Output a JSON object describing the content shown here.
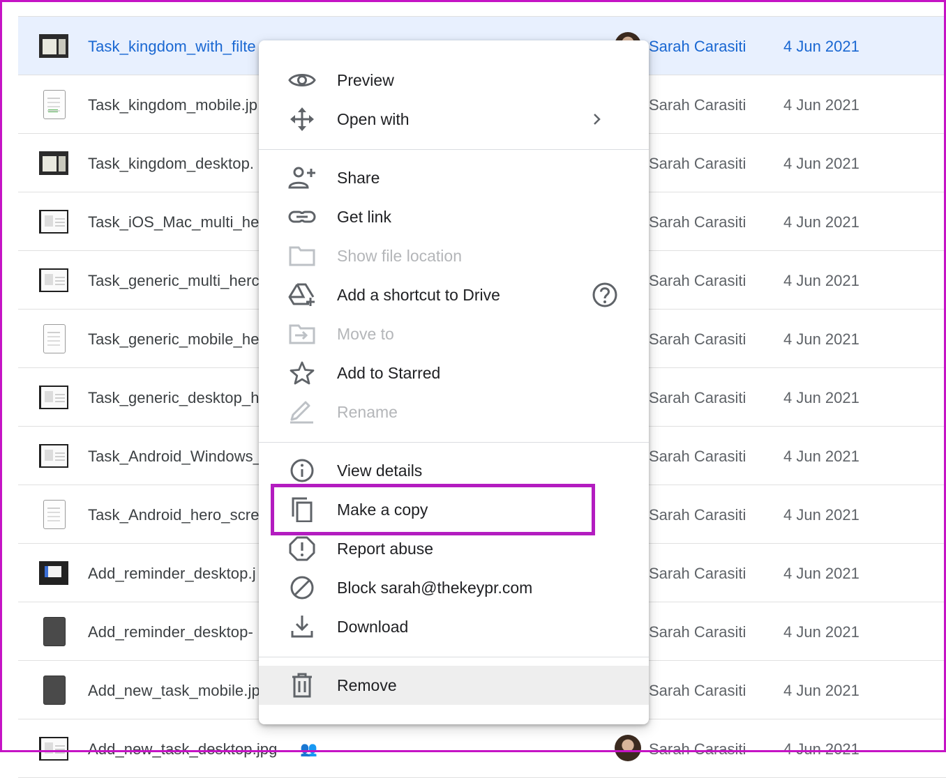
{
  "files": [
    {
      "name": "Task_kingdom_with_filte",
      "owner": "Sarah Carasiti",
      "modified": "4 Jun 2021",
      "thumb": "land dark",
      "selected": true,
      "shared": true
    },
    {
      "name": "Task_kingdom_mobile.jp",
      "owner": "Sarah Carasiti",
      "modified": "4 Jun 2021",
      "thumb": "port green"
    },
    {
      "name": "Task_kingdom_desktop.",
      "owner": "Sarah Carasiti",
      "modified": "4 Jun 2021",
      "thumb": "land dark"
    },
    {
      "name": "Task_iOS_Mac_multi_he",
      "owner": "Sarah Carasiti",
      "modified": "4 Jun 2021",
      "thumb": "land light"
    },
    {
      "name": "Task_generic_multi_herc",
      "owner": "Sarah Carasiti",
      "modified": "4 Jun 2021",
      "thumb": "land light"
    },
    {
      "name": "Task_generic_mobile_he",
      "owner": "Sarah Carasiti",
      "modified": "4 Jun 2021",
      "thumb": "port"
    },
    {
      "name": "Task_generic_desktop_h",
      "owner": "Sarah Carasiti",
      "modified": "4 Jun 2021",
      "thumb": "land light"
    },
    {
      "name": "Task_Android_Windows_",
      "owner": "Sarah Carasiti",
      "modified": "4 Jun 2021",
      "thumb": "land light"
    },
    {
      "name": "Task_Android_hero_scre",
      "owner": "Sarah Carasiti",
      "modified": "4 Jun 2021",
      "thumb": "port"
    },
    {
      "name": "Add_reminder_desktop.j",
      "owner": "Sarah Carasiti",
      "modified": "4 Jun 2021",
      "thumb": "land blue"
    },
    {
      "name": "Add_reminder_desktop-",
      "owner": "Sarah Carasiti",
      "modified": "4 Jun 2021",
      "thumb": "port dark"
    },
    {
      "name": "Add_new_task_mobile.jp",
      "owner": "Sarah Carasiti",
      "modified": "4 Jun 2021",
      "thumb": "port dark"
    },
    {
      "name": "Add_new_task_desktop.jpg",
      "owner": "Sarah Carasiti",
      "modified": "4 Jun 2021",
      "thumb": "land light",
      "shared": true,
      "avatar": true
    }
  ],
  "menu": {
    "preview": "Preview",
    "open_with": "Open with",
    "share": "Share",
    "get_link": "Get link",
    "show_file_location": "Show file location",
    "add_shortcut": "Add a shortcut to Drive",
    "move_to": "Move to",
    "add_starred": "Add to Starred",
    "rename": "Rename",
    "view_details": "View details",
    "make_copy": "Make a copy",
    "report_abuse": "Report abuse",
    "block": "Block sarah@thekeypr.com",
    "download": "Download",
    "remove": "Remove"
  },
  "colors": {
    "accent": "#1967d2",
    "selected_row": "#e8f0fe",
    "highlight": "#b31cc0",
    "frame": "#c513c5"
  }
}
